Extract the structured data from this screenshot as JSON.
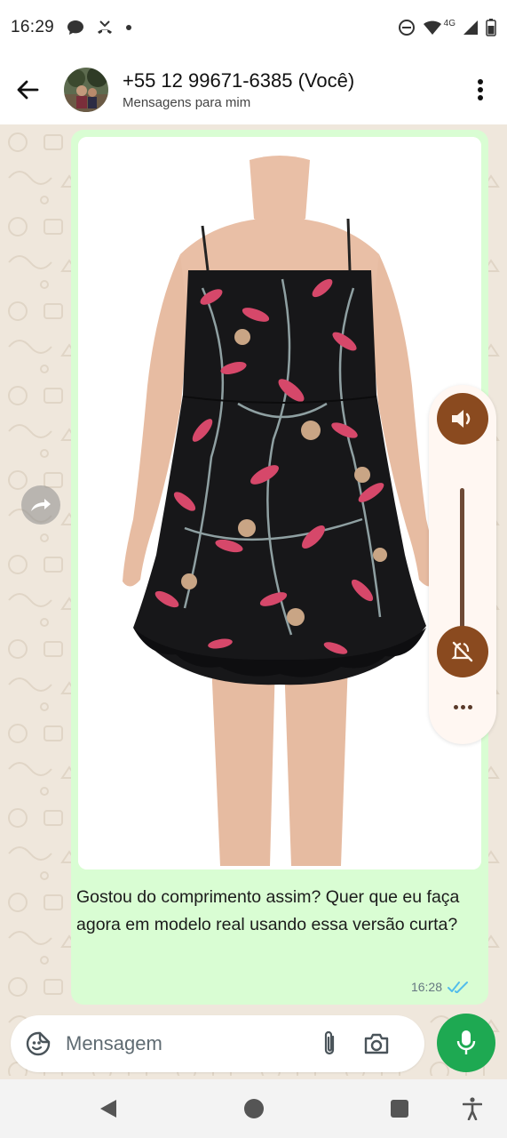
{
  "status_bar": {
    "time": "16:29",
    "network_label": "4G"
  },
  "header": {
    "contact_name": "+55 12 99671-6385 (Você)",
    "subtitle": "Mensagens para mim"
  },
  "message": {
    "text": "Gostou do comprimento assim? Quer que eu faça agora em modelo real usando essa versão curta?",
    "time": "16:28",
    "status_icon": "double-check-read-icon"
  },
  "composer": {
    "placeholder": "Mensagem"
  },
  "colors": {
    "bubble": "#d9fdd3",
    "chat_background": "#efe7dc",
    "mic_button": "#1ea952",
    "volume_button": "#8a4a1f",
    "read_ticks": "#53bdeb"
  },
  "icons": {
    "back": "arrow-left-icon",
    "menu": "more-vertical-icon",
    "forward": "forward-icon",
    "volume": "speaker-icon",
    "mute": "mute-icon",
    "emoji": "sticker-icon",
    "attach": "paperclip-icon",
    "camera": "camera-icon",
    "mic": "microphone-icon"
  }
}
